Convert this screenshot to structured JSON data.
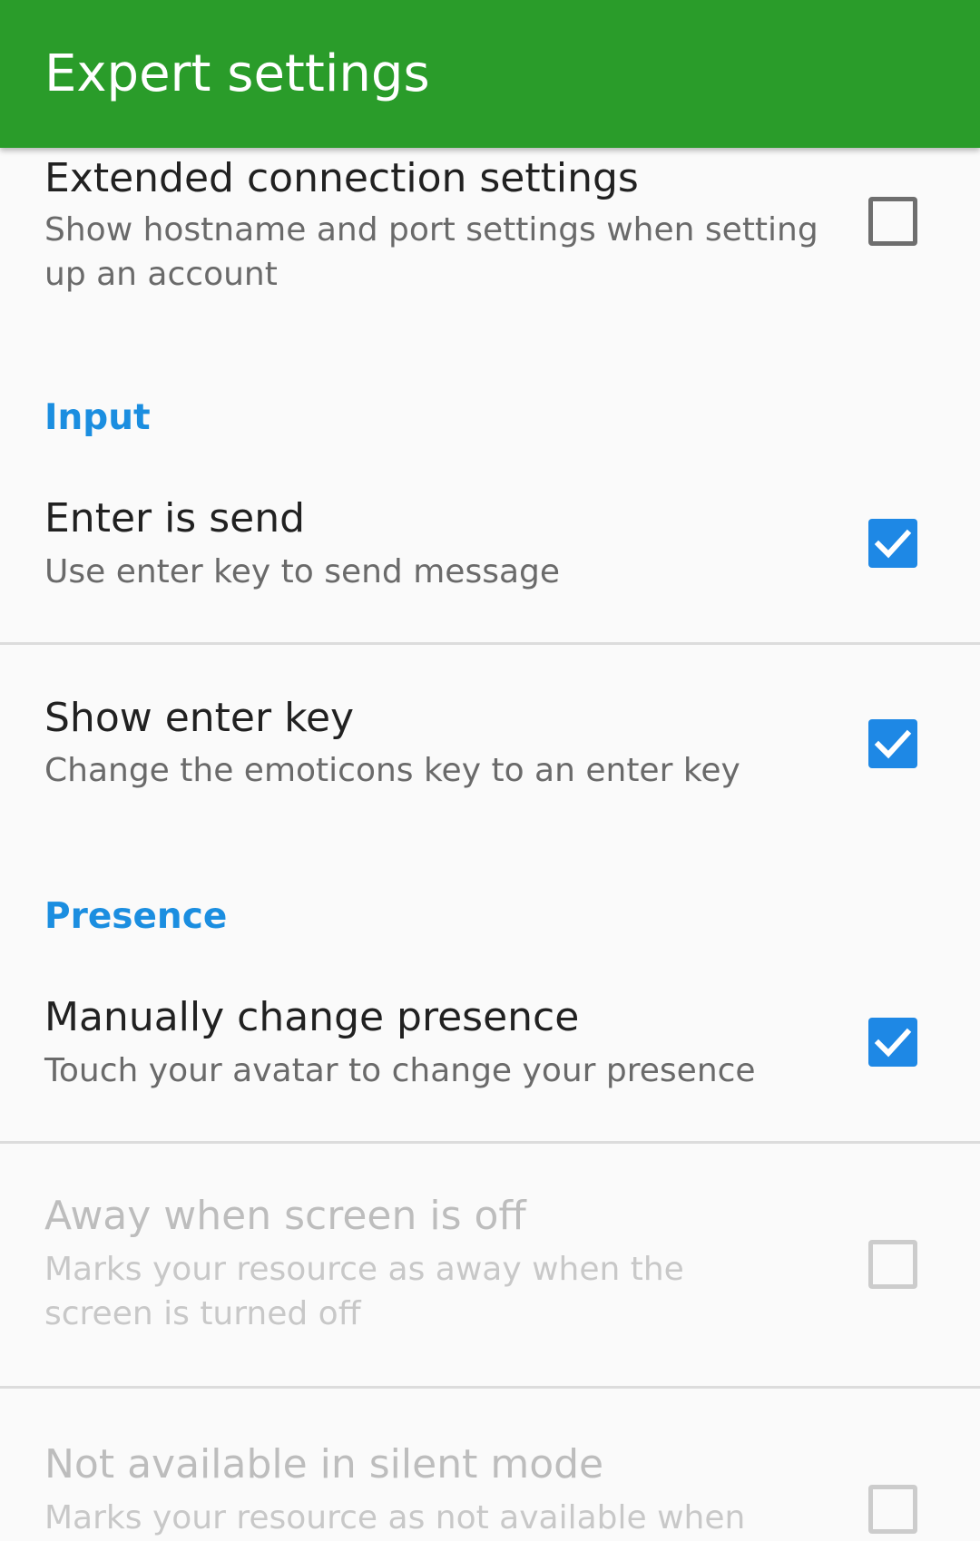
{
  "appbar": {
    "title": "Expert settings",
    "color": "#2a9c2a"
  },
  "categories": {
    "input": "Input",
    "presence": "Presence"
  },
  "prefs": {
    "extended_connection": {
      "title": "Extended connection settings",
      "summary": "Show hostname and port settings when setting up an account",
      "checked": false,
      "enabled": true
    },
    "enter_is_send": {
      "title": "Enter is send",
      "summary": "Use enter key to send message",
      "checked": true,
      "enabled": true
    },
    "show_enter_key": {
      "title": "Show enter key",
      "summary": "Change the emoticons key to an enter key",
      "checked": true,
      "enabled": true
    },
    "manually_change_presence": {
      "title": "Manually change presence",
      "summary": "Touch your avatar to change your presence",
      "checked": true,
      "enabled": true
    },
    "away_when_screen_off": {
      "title": "Away when screen is off",
      "summary": "Marks your resource as away when the screen is turned off",
      "checked": false,
      "enabled": false
    },
    "not_available_silent": {
      "title": "Not available in silent mode",
      "summary": "Marks your resource as not available when",
      "checked": false,
      "enabled": false
    }
  },
  "colors": {
    "accent": "#1e88e5",
    "category": "#1b8ee0"
  },
  "icons": {
    "checked": "checkmark-icon"
  }
}
